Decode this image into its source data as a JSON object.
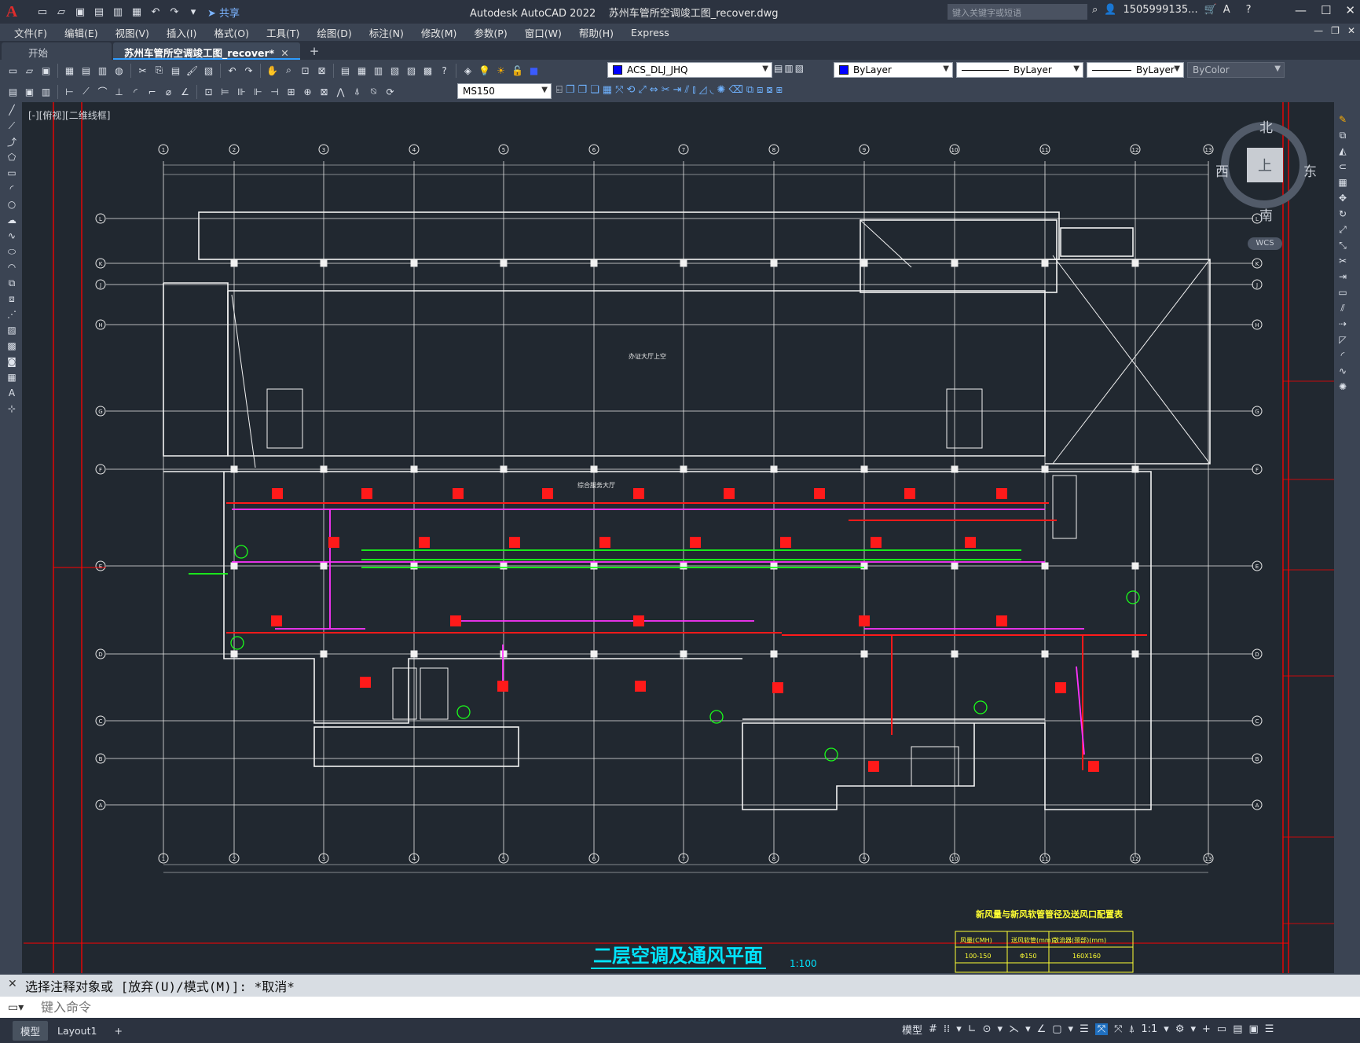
{
  "titlebar": {
    "app_title": "Autodesk AutoCAD 2022",
    "file_title": "苏州车管所空调竣工图_recover.dwg",
    "share_label": "共享",
    "search_placeholder": "键入关键字或短语",
    "user": "1505999135..."
  },
  "menu": [
    "文件(F)",
    "编辑(E)",
    "视图(V)",
    "插入(I)",
    "格式(O)",
    "工具(T)",
    "绘图(D)",
    "标注(N)",
    "修改(M)",
    "参数(P)",
    "窗口(W)",
    "帮助(H)",
    "Express"
  ],
  "tabs": {
    "start": "开始",
    "active": "苏州车管所空调竣工图_recover*"
  },
  "toolbar": {
    "layer": "ACS_DLJ_JHQ",
    "color": "ByLayer",
    "linetype": "ByLayer",
    "lineweight": "ByLayer",
    "plotstyle": "ByColor",
    "dimstyle": "MS150",
    "layer_color": "#0000ff"
  },
  "viewport": {
    "label": "[-][俯视][二维线框]",
    "compass": {
      "north": "北",
      "south": "南",
      "east": "东",
      "west": "西",
      "face": "上"
    },
    "wcs": "WCS"
  },
  "drawing": {
    "title": "二层空调及通风平面",
    "scale": "1:100",
    "table_title": "新风量与新风软管管径及送风口配置表",
    "table_headers": [
      "风量(CMH)",
      "送风软管(mm)",
      "散流器(颈部)(mm)"
    ],
    "table_row1": [
      "100-150",
      "Φ150",
      "160X160"
    ],
    "room_label_1": "办证大厅上空",
    "room_label_2": "综合服务大厅",
    "grid_top": [
      "1",
      "2",
      "3",
      "4",
      "5",
      "6",
      "7",
      "8",
      "9",
      "10",
      "11",
      "12",
      "13"
    ],
    "grid_left": [
      "L",
      "K",
      "J",
      "H",
      "G",
      "F",
      "E",
      "D",
      "C",
      "B",
      "A"
    ],
    "colors": {
      "duct_red": "#ff1a1a",
      "duct_green": "#1aff1a",
      "pipe_magenta": "#ff33ff",
      "line_white": "#f2f2f2",
      "frame_red": "#ff0000",
      "title_cyan": "#00e5ff",
      "table_yellow": "#ffff33"
    }
  },
  "command": {
    "history": "选择注释对象或 [放弃(U)/模式(M)]: *取消*",
    "placeholder": "键入命令"
  },
  "statusbar": {
    "model_tab": "模型",
    "layout_tab": "Layout1",
    "model_label": "模型",
    "scale": "1:1"
  }
}
